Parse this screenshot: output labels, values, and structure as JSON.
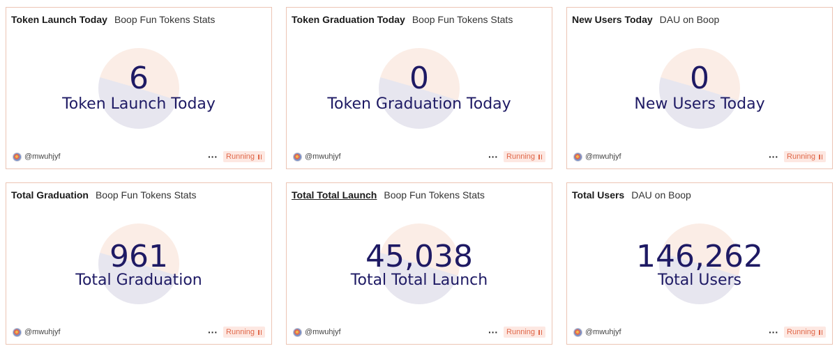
{
  "footer_common": {
    "author": "@mwuhjyf",
    "more_label": "···",
    "status_label": "Running"
  },
  "cards": [
    {
      "title": "Token Launch Today",
      "subtitle": "Boop Fun Tokens Stats",
      "value": "6",
      "label": "Token Launch Today"
    },
    {
      "title": "Token Graduation Today",
      "subtitle": "Boop Fun Tokens Stats",
      "value": "0",
      "label": "Token Graduation Today"
    },
    {
      "title": "New Users Today",
      "subtitle": "DAU on Boop",
      "value": "0",
      "label": "New Users Today"
    },
    {
      "title": "Total Graduation",
      "subtitle": "Boop Fun Tokens Stats",
      "value": "961",
      "label": "Total Graduation"
    },
    {
      "title": "Total Total Launch",
      "subtitle": "Boop Fun Tokens Stats",
      "value": "45,038",
      "label": "Total Total Launch"
    },
    {
      "title": "Total Users",
      "subtitle": "DAU on Boop",
      "value": "146,262",
      "label": "Total Users"
    }
  ],
  "colors": {
    "card_border": "#ecc4b4",
    "value_text": "#1e1a64",
    "badge_bg": "#fde8e2",
    "badge_text": "#e0684a",
    "pie_light": "#fbede6",
    "pie_dark": "#e7e6ef"
  },
  "icons": {
    "avatar": "user-avatar-icon",
    "more": "more-horizontal-icon",
    "status": "pause-icon"
  }
}
